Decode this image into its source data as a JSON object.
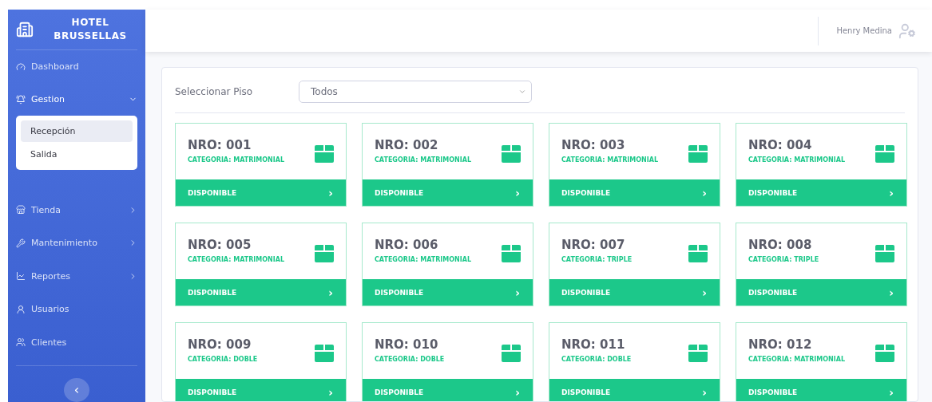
{
  "brand": {
    "line1": "HOTEL",
    "line2": "BRUSSELLAS"
  },
  "sidebar": {
    "items": [
      {
        "label": "Dashboard",
        "expandable": false,
        "expanded": false
      },
      {
        "label": "Gestion",
        "expandable": true,
        "expanded": true,
        "children": [
          {
            "label": "Recepción",
            "selected": true
          },
          {
            "label": "Salida",
            "selected": false
          }
        ]
      },
      {
        "label": "Tienda",
        "expandable": true,
        "expanded": false
      },
      {
        "label": "Mantenimiento",
        "expandable": true,
        "expanded": false
      },
      {
        "label": "Reportes",
        "expandable": true,
        "expanded": false
      },
      {
        "label": "Usuarios",
        "expandable": false,
        "expanded": false
      },
      {
        "label": "Clientes",
        "expandable": false,
        "expanded": false
      }
    ],
    "collapse_button": "‹"
  },
  "header": {
    "user_name": "Henry Medina"
  },
  "filter": {
    "label": "Seleccionar Piso",
    "value": "Todos"
  },
  "rooms": [
    {
      "number": "NRO: 001",
      "category": "CATEGORIA: MATRIMONIAL",
      "status": "DISPONIBLE",
      "action": "›"
    },
    {
      "number": "NRO: 002",
      "category": "CATEGORIA: MATRIMONIAL",
      "status": "DISPONIBLE",
      "action": "›"
    },
    {
      "number": "NRO: 003",
      "category": "CATEGORIA: MATRIMONIAL",
      "status": "DISPONIBLE",
      "action": "›"
    },
    {
      "number": "NRO: 004",
      "category": "CATEGORIA: MATRIMONIAL",
      "status": "DISPONIBLE",
      "action": "›"
    },
    {
      "number": "NRO: 005",
      "category": "CATEGORIA: MATRIMONIAL",
      "status": "DISPONIBLE",
      "action": "›"
    },
    {
      "number": "NRO: 006",
      "category": "CATEGORIA: MATRIMONIAL",
      "status": "DISPONIBLE",
      "action": "›"
    },
    {
      "number": "NRO: 007",
      "category": "CATEGORIA: TRIPLE",
      "status": "DISPONIBLE",
      "action": "›"
    },
    {
      "number": "NRO: 008",
      "category": "CATEGORIA: TRIPLE",
      "status": "DISPONIBLE",
      "action": "›"
    },
    {
      "number": "NRO: 009",
      "category": "CATEGORIA: DOBLE",
      "status": "DISPONIBLE",
      "action": "›"
    },
    {
      "number": "NRO: 010",
      "category": "CATEGORIA: DOBLE",
      "status": "DISPONIBLE",
      "action": "›"
    },
    {
      "number": "NRO: 011",
      "category": "CATEGORIA: DOBLE",
      "status": "DISPONIBLE",
      "action": "›"
    },
    {
      "number": "NRO: 012",
      "category": "CATEGORIA: MATRIMONIAL",
      "status": "DISPONIBLE",
      "action": "›"
    }
  ]
}
